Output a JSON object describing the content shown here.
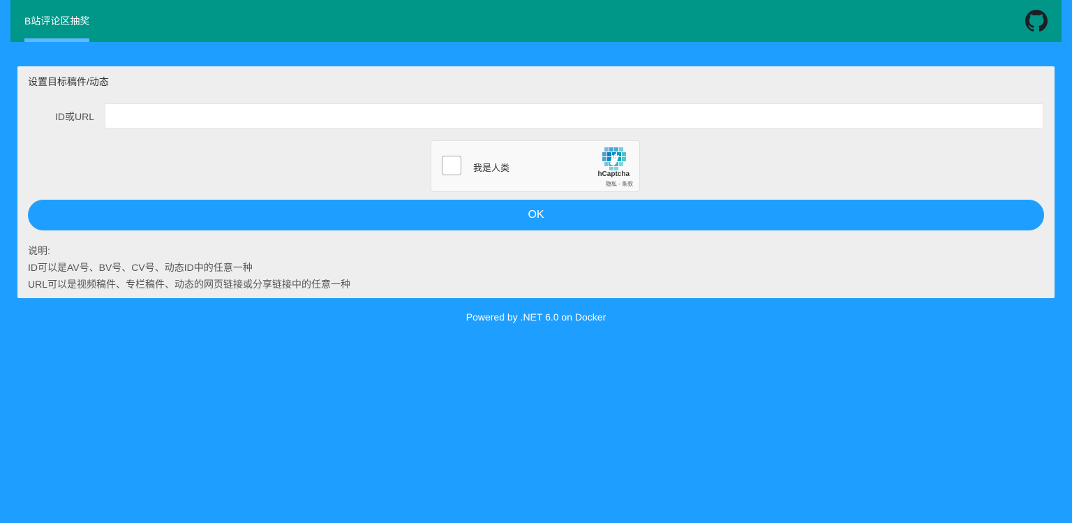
{
  "header": {
    "nav_item": "B站评论区抽奖",
    "github_icon": "github-icon"
  },
  "card": {
    "title": "设置目标稿件/动态",
    "field_label": "ID或URL",
    "field_value": "",
    "field_placeholder": ""
  },
  "captcha": {
    "checkbox_label": "我是人类",
    "brand": "hCaptcha",
    "links": "隐私 - 条款",
    "logo_icon": "hcaptcha-logo-icon"
  },
  "ok_button": "OK",
  "notes": {
    "heading": "说明:",
    "line1": "ID可以是AV号、BV号、CV号、动态ID中的任意一种",
    "line2": "URL可以是视频稿件、专栏稿件、动态的网页链接或分享链接中的任意一种"
  },
  "footer": "Powered by .NET 6.0 on Docker",
  "colors": {
    "page_background": "#1e9fff",
    "header_background": "#009688",
    "nav_underline": "#5fb8ff",
    "card_background": "#eeeeee",
    "button": "#1e9fff"
  }
}
